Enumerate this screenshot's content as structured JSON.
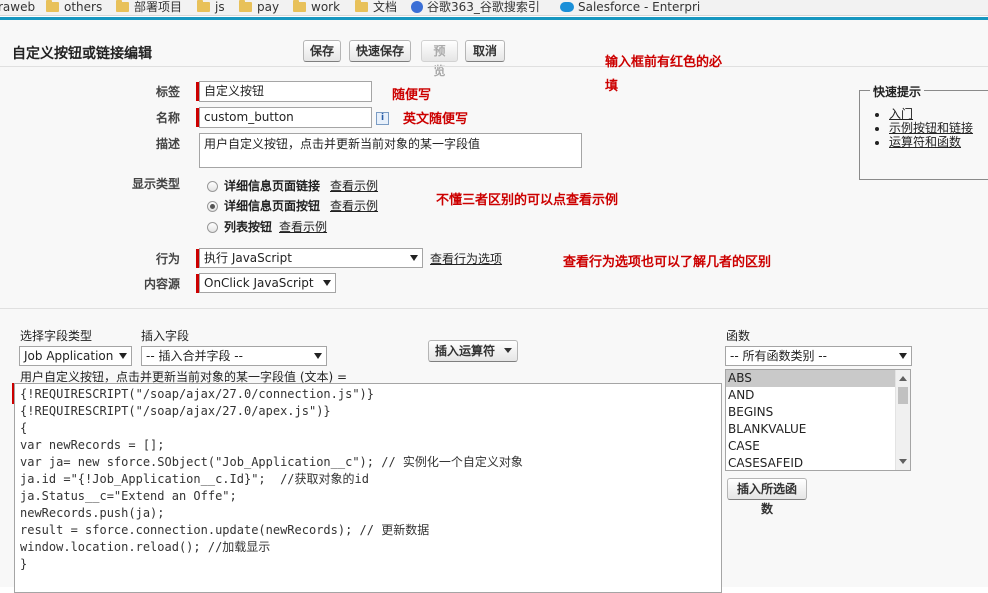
{
  "bookmarks": [
    {
      "label": "raweb",
      "icon": "none"
    },
    {
      "label": "others",
      "icon": "folder-icon"
    },
    {
      "label": "部署项目",
      "icon": "folder-icon"
    },
    {
      "label": "js",
      "icon": "folder-icon"
    },
    {
      "label": "pay",
      "icon": "folder-icon"
    },
    {
      "label": "work",
      "icon": "folder-icon"
    },
    {
      "label": "文档",
      "icon": "folder-icon"
    },
    {
      "label": "谷歌363_谷歌搜索引",
      "icon": "site-363-icon"
    },
    {
      "label": "Salesforce - Enterpri",
      "icon": "salesforce-icon"
    }
  ],
  "header": {
    "title": "自定义按钮或链接编辑",
    "buttons": {
      "save": "保存",
      "quick_save": "快速保存",
      "preview": "预览",
      "cancel": "取消"
    }
  },
  "annotations": {
    "required": "输入框前有红色的必",
    "required2": "填",
    "label_note": "随便写",
    "name_note": "英文随便写",
    "type_note": "不懂三者区别的可以点查看示例",
    "behavior_note": "查看行为选项也可以了解几者的区别"
  },
  "form": {
    "label_label": "标签",
    "label_value": "自定义按钮",
    "name_label": "名称",
    "name_value": "custom_button",
    "desc_label": "描述",
    "desc_value": "用户自定义按钮，点击并更新当前对象的某一字段值",
    "display_type_label": "显示类型",
    "display_types": [
      {
        "label": "详细信息页面链接",
        "link": "查看示例",
        "checked": false
      },
      {
        "label": "详细信息页面按钮",
        "link": "查看示例",
        "checked": true
      },
      {
        "label": "列表按钮",
        "link": "查看示例",
        "checked": false
      }
    ],
    "behavior_label": "行为",
    "behavior_value": "执行 JavaScript",
    "behavior_link": "查看行为选项",
    "content_source_label": "内容源",
    "content_source_value": "OnClick JavaScript"
  },
  "quick_tips": {
    "title": "快速提示",
    "items": [
      "入门",
      "示例按钮和链接",
      "运算符和函数"
    ]
  },
  "formula": {
    "field_type_label": "选择字段类型",
    "field_type_value": "Job Application",
    "insert_field_label": "插入字段",
    "insert_field_value": "-- 插入合并字段 --",
    "insert_operator": "插入运算符",
    "functions_label": "函数",
    "functions_category": "-- 所有函数类别 --",
    "functions": [
      "ABS",
      "AND",
      "BEGINS",
      "BLANKVALUE",
      "CASE",
      "CASESAFEID"
    ],
    "insert_function": "插入所选函数",
    "editor_caption": "用户自定义按钮，点击并更新当前对象的某一字段值 (文本) =",
    "code_lines": [
      "{!REQUIRESCRIPT(\"/soap/ajax/27.0/connection.js\")}",
      "{!REQUIRESCRIPT(\"/soap/ajax/27.0/apex.js\")}",
      "{",
      "var newRecords = [];",
      "var ja= new sforce.SObject(\"Job_Application__c\"); // 实例化一个自定义对象",
      "ja.id =\"{!Job_Application__c.Id}\";  //获取对象的id",
      "ja.Status__c=\"Extend an Offe\";",
      "newRecords.push(ja);",
      "result = sforce.connection.update(newRecords); // 更新数据",
      "window.location.reload(); //加载显示",
      "}"
    ]
  }
}
